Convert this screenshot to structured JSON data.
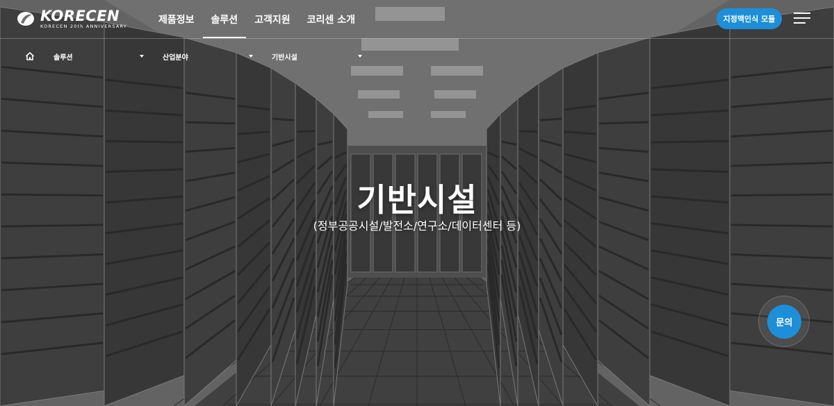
{
  "brand": {
    "name": "KORECEN",
    "tagline": "KORECEN 20th ANNIVERSARY",
    "accent_color": "#1d8fd9"
  },
  "nav": {
    "items": [
      {
        "label": "제품정보",
        "active": false
      },
      {
        "label": "솔루션",
        "active": true
      },
      {
        "label": "고객지원",
        "active": false
      },
      {
        "label": "코리센 소개",
        "active": false
      }
    ],
    "cta_label": "지정맥인식 모듈",
    "menu_icon": "hamburger-icon"
  },
  "breadcrumb": {
    "home_icon": "home-icon",
    "items": [
      {
        "label": "솔루션"
      },
      {
        "label": "산업분야"
      },
      {
        "label": "기반시설"
      }
    ]
  },
  "hero": {
    "title": "기반시설",
    "subtitle": "(정부공공시설/발전소/연구소/데이터센터 등)"
  },
  "inquiry": {
    "label": "문의"
  }
}
